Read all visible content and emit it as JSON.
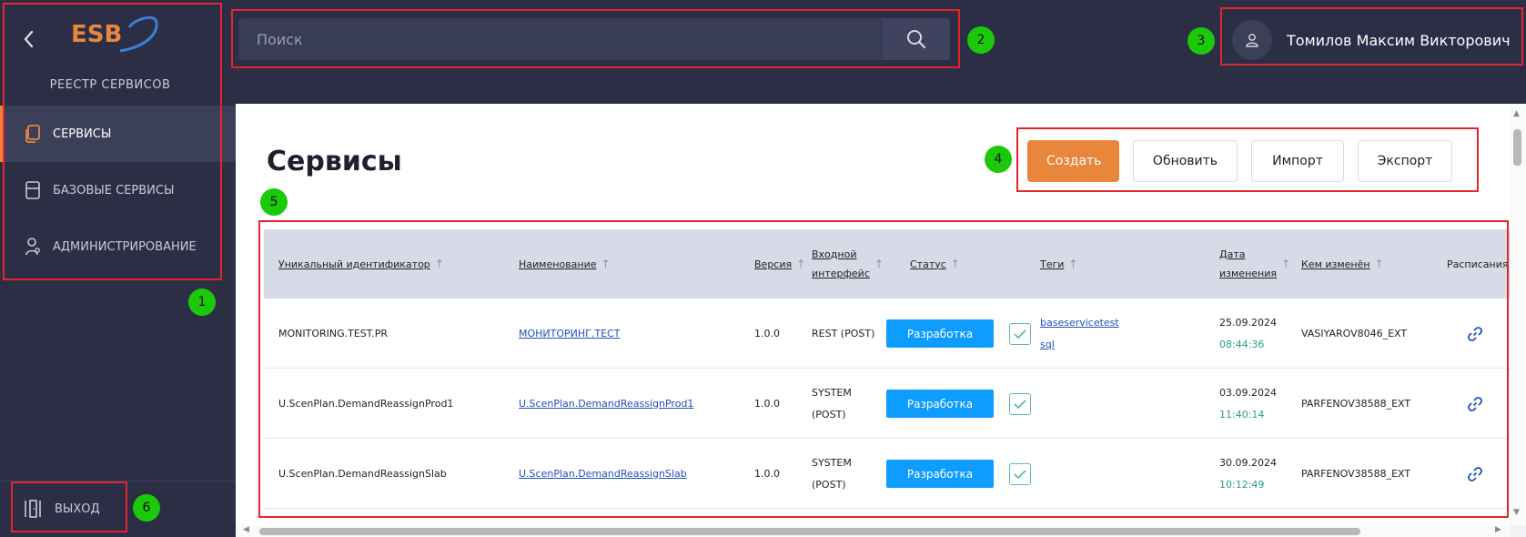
{
  "sidebar": {
    "back_icon": "chevron-left-icon",
    "logo_text": "ESB",
    "title": "РЕЕСТР СЕРВИСОВ",
    "items": [
      {
        "label": "СЕРВИСЫ",
        "icon": "documents-icon",
        "active": true
      },
      {
        "label": "БАЗОВЫЕ СЕРВИСЫ",
        "icon": "server-icon",
        "active": false
      },
      {
        "label": "АДМИНИСТРИРОВАНИЕ",
        "icon": "admin-icon",
        "active": false
      }
    ],
    "logout_label": "ВЫХОД"
  },
  "search": {
    "placeholder": "Поиск",
    "value": ""
  },
  "user": {
    "name": "Томилов Максим Викторович"
  },
  "page": {
    "title": "Сервисы"
  },
  "actions": {
    "create": "Создать",
    "refresh": "Обновить",
    "import": "Импорт",
    "export": "Экспорт"
  },
  "colors": {
    "accent": "#e8873c",
    "sidebar": "#2b2e45",
    "status": "#0e9dff",
    "time": "#2a9a88"
  },
  "table": {
    "columns": {
      "id": "Уникальный идентификатор",
      "name": "Наименование",
      "version": "Версия",
      "iface_line1": "Входной",
      "iface_line2": "интерфейс",
      "status": "Статус",
      "tags": "Теги",
      "date_line1": "Дата",
      "date_line2": "изменения",
      "changed_by": "Кем изменён",
      "schedule": "Расписания"
    },
    "rows": [
      {
        "id": "MONITORING.TEST.PR",
        "name": "МОНИТОРИНГ.ТЕСТ",
        "version": "1.0.0",
        "iface1": "REST (POST)",
        "iface2": "",
        "status": "Разработка",
        "tag1": "baseservicetest",
        "tag2": "sql",
        "date": "25.09.2024",
        "time": "08:44:36",
        "changed_by": "VASIYAROV8046_EXT"
      },
      {
        "id": "U.ScenPlan.DemandReassignProd1",
        "name": "U.ScenPlan.DemandReassignProd1",
        "version": "1.0.0",
        "iface1": "SYSTEM",
        "iface2": "(POST)",
        "status": "Разработка",
        "tag1": "",
        "tag2": "",
        "date": "03.09.2024",
        "time": "11:40:14",
        "changed_by": "PARFENOV38588_EXT"
      },
      {
        "id": "U.ScenPlan.DemandReassignSlab",
        "name": "U.ScenPlan.DemandReassignSlab",
        "version": "1.0.0",
        "iface1": "SYSTEM",
        "iface2": "(POST)",
        "status": "Разработка",
        "tag1": "",
        "tag2": "",
        "date": "30.09.2024",
        "time": "10:12:49",
        "changed_by": "PARFENOV38588_EXT"
      }
    ]
  },
  "markers": [
    "1",
    "2",
    "3",
    "4",
    "5",
    "6"
  ]
}
